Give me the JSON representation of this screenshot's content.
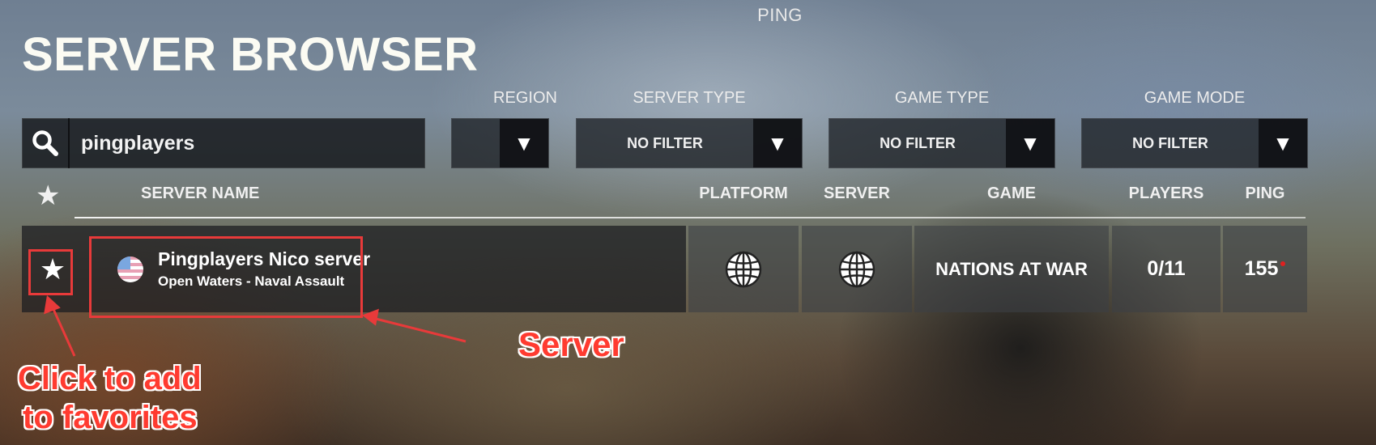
{
  "page": {
    "top_title": "PING",
    "title": "SERVER BROWSER"
  },
  "search": {
    "value": "pingplayers",
    "icon": "search-icon"
  },
  "filters": {
    "region": {
      "label": "REGION",
      "value": ""
    },
    "server_type": {
      "label": "SERVER TYPE",
      "value": "NO FILTER"
    },
    "game_type": {
      "label": "GAME TYPE",
      "value": "NO FILTER"
    },
    "game_mode": {
      "label": "GAME MODE",
      "value": "NO FILTER"
    },
    "arrow_glyph": "▼"
  },
  "table": {
    "headers": {
      "favorite_icon": "★",
      "server_name": "SERVER NAME",
      "platform": "PLATFORM",
      "server": "SERVER",
      "game": "GAME",
      "players": "PLAYERS",
      "ping": "PING"
    },
    "rows": [
      {
        "favorite_icon": "★",
        "flag": "us-flag-icon",
        "name": "Pingplayers Nico server",
        "map": "Open Waters - Naval Assault",
        "platform_icon": "globe-icon",
        "server_icon": "globe-icon",
        "game": "NATIONS AT WAR",
        "players": "0/11",
        "ping": "155",
        "ping_status_color": "#e02020"
      }
    ]
  },
  "annotations": {
    "favorite_hint": [
      "Click to add",
      "to favorites"
    ],
    "server_hint": "Server",
    "color": "#e83a3a"
  }
}
